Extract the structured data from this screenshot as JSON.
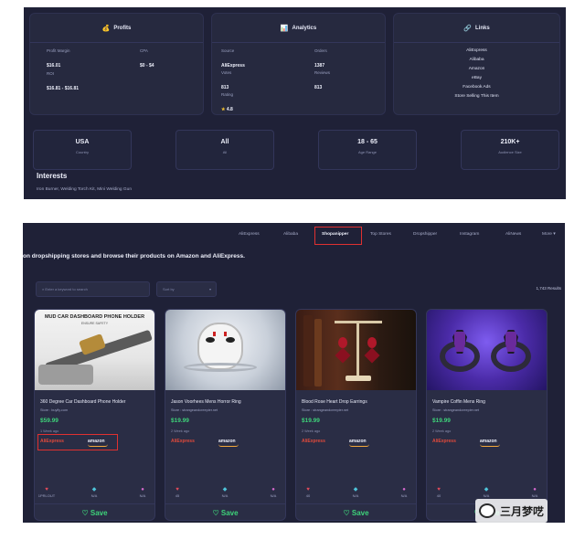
{
  "profits": {
    "title": "Profits",
    "icon": "money-bag-icon",
    "fields": [
      {
        "label": "Profit Margin",
        "value": "$16.01"
      },
      {
        "label": "CPA",
        "value": "$0 - $4"
      },
      {
        "label": "ROI",
        "value": "$16.81 - $16.81"
      }
    ]
  },
  "analytics": {
    "title": "Analytics",
    "icon": "chart-icon",
    "fields": [
      {
        "label": "Source",
        "value": "AliExpress"
      },
      {
        "label": "Orders",
        "value": "1387"
      },
      {
        "label": "Votes",
        "value": "813"
      },
      {
        "label": "Reviews",
        "value": "813"
      },
      {
        "label": "Rating",
        "value": "4.8"
      }
    ]
  },
  "links": {
    "title": "Links",
    "icon": "link-icon",
    "items": [
      "AliExpress",
      "Alibaba",
      "Amazon",
      "eBay",
      "Facebook Ads",
      "Store Selling This Item"
    ]
  },
  "stats": [
    {
      "value": "USA",
      "label": "Country"
    },
    {
      "value": "All",
      "label": "All"
    },
    {
      "value": "18 - 65",
      "label": "Age Range"
    },
    {
      "value": "210K+",
      "label": "Audience Size"
    }
  ],
  "interests": {
    "heading": "Interests",
    "text": "Iron Burner, Welding Torch Kit, Mini Welding Gun"
  },
  "nav": {
    "items": [
      "AliExpress",
      "Alibaba",
      "Shopanipper",
      "Top Stores",
      "Dropshipper",
      "Instagram",
      "AliNews",
      "More"
    ],
    "active_index": 2
  },
  "intro_text": "on dropshipping stores and browse their products on Amazon and AliExpress.",
  "search": {
    "placeholder": "Enter a keyword to search",
    "sort_placeholder": "Sort by",
    "results": "1,743 Results"
  },
  "products": [
    {
      "title": "360 Degree Car Dashboard Phone Holder",
      "store": "Store : buyfly.com",
      "price": "$59.99",
      "ago": "1 Week ago",
      "ali": "AliExpress",
      "amz": "amazon",
      "likes": "1PRLOUT",
      "saves": "N/A",
      "shares": "N/A",
      "banner": "MUD CAR DASHBOARD PHONE HOLDER",
      "banner_sub": "ENSURE SAFETY"
    },
    {
      "title": "Jason Voorhees Mens Horror Ring",
      "store": "Store : strangeandcreepier.net",
      "price": "$19.99",
      "ago": "2 Week ago",
      "ali": "AliExpress",
      "amz": "amazon",
      "likes": "45",
      "saves": "N/A",
      "shares": "N/A"
    },
    {
      "title": "Blood Rose Heart Drop Earrings",
      "store": "Store : strangeandcreepier.net",
      "price": "$19.99",
      "ago": "2 Week ago",
      "ali": "AliExpress",
      "amz": "amazon",
      "likes": "40",
      "saves": "N/A",
      "shares": "N/A"
    },
    {
      "title": "Vampire Coffin Mens Ring",
      "store": "Store : strangeandcreepier.net",
      "price": "$19.99",
      "ago": "2 Week ago",
      "ali": "AliExpress",
      "amz": "amazon",
      "likes": "40",
      "saves": "N/A",
      "shares": "N/A"
    }
  ],
  "save_label": "Save",
  "watermark": "三月梦呓",
  "colors": {
    "panel": "#1f2137",
    "card": "#26293f",
    "green": "#3ed37a",
    "highlight": "#e03030"
  }
}
